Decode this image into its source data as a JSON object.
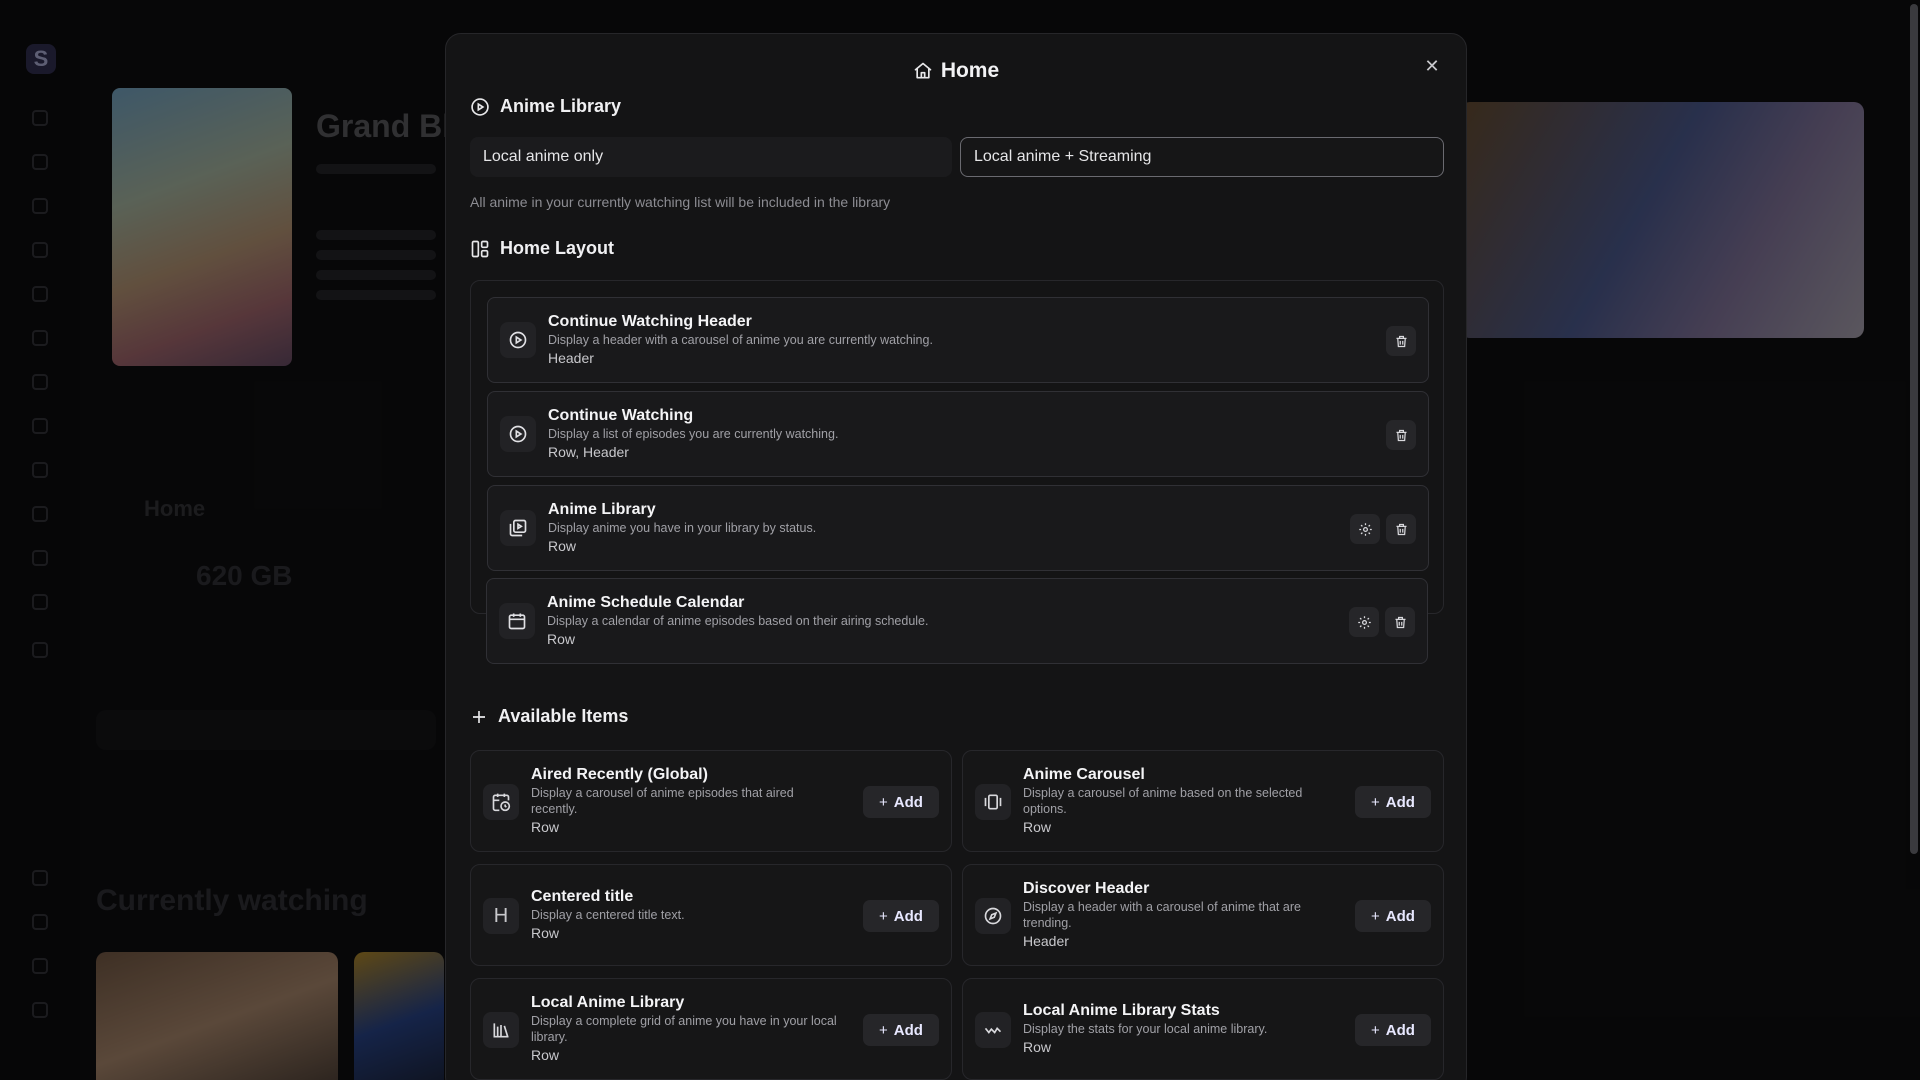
{
  "modal": {
    "title": "Home",
    "anime_library_section": {
      "title": "Anime Library",
      "options": [
        "Local anime only",
        "Local anime + Streaming"
      ],
      "selected": "Local anime + Streaming",
      "help_text": "All anime in your currently watching list will be included in the library"
    },
    "home_layout_section": {
      "title": "Home Layout",
      "items": [
        {
          "title": "Continue Watching Header",
          "description": "Display a header with a carousel of anime you are currently watching.",
          "tag": "Header",
          "icon": "play-circle-icon",
          "has_settings": false
        },
        {
          "title": "Continue Watching",
          "description": "Display a list of episodes you are currently watching.",
          "tag": "Row, Header",
          "icon": "play-circle-icon",
          "has_settings": false
        },
        {
          "title": "Anime Library",
          "description": "Display anime you have in your library by status.",
          "tag": "Row",
          "icon": "library-play-icon",
          "has_settings": true
        },
        {
          "title": "Anime Schedule Calendar",
          "description": "Display a calendar of anime episodes based on their airing schedule.",
          "tag": "Row",
          "icon": "calendar-icon",
          "has_settings": true
        }
      ]
    },
    "available_section": {
      "title": "Available Items",
      "add_label": "Add",
      "items": [
        {
          "title": "Aired Recently (Global)",
          "description_lines": [
            "Display a carousel of anime episodes that aired",
            "recently."
          ],
          "tag": "Row",
          "icon": "calendar-clock-icon"
        },
        {
          "title": "Anime Carousel",
          "description_lines": [
            "Display a carousel of anime based on the selected",
            "options."
          ],
          "tag": "Row",
          "icon": "carousel-icon"
        },
        {
          "title": "Centered title",
          "description_lines": [
            "Display a centered title text."
          ],
          "tag": "Row",
          "icon": "heading-icon"
        },
        {
          "title": "Discover Header",
          "description_lines": [
            "Display a header with a carousel of anime that are",
            "trending."
          ],
          "tag": "Header",
          "icon": "compass-icon"
        },
        {
          "title": "Local Anime Library",
          "description_lines": [
            "Display a complete grid of anime you have in your local",
            "library."
          ],
          "tag": "Row",
          "icon": "library-icon"
        },
        {
          "title": "Local Anime Library Stats",
          "description_lines": [
            "Display the stats for your local anime library."
          ],
          "tag": "Row",
          "icon": "stats-wave-icon"
        }
      ]
    }
  },
  "colors": {
    "modal_bg": "#141415",
    "card_bg": "#19191b",
    "accent_text": "#e8e8ff",
    "muted_text": "#a0a0a6"
  }
}
